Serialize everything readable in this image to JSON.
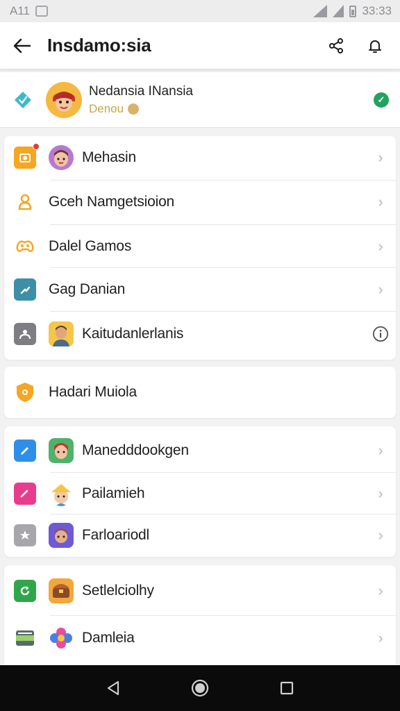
{
  "status": {
    "left_text": "A11",
    "time": "33:33"
  },
  "header": {
    "title": "Insdamo:sia"
  },
  "profile": {
    "name": "Nedansia INansia",
    "subtitle": "Denou"
  },
  "groups": [
    {
      "items": [
        {
          "label": "Mehasin",
          "icon": "camera-icon",
          "icon_color": "#f5a623",
          "avatar": "girl-avatar",
          "trailing": "chevron",
          "badge": true
        },
        {
          "label": "Gceh Namgetsioion",
          "icon": "person-icon",
          "icon_color": "#f5a623",
          "trailing": "chevron"
        },
        {
          "label": "Dalel Gamos",
          "icon": "gamepad-icon",
          "icon_color": "#f5a623",
          "trailing": "chevron"
        },
        {
          "label": "Gag Danian",
          "icon": "chart-icon",
          "icon_color": "#3d8fa8",
          "trailing": "chevron"
        },
        {
          "label": "Kaitudanlerlanis",
          "icon": "people-icon",
          "icon_color": "#7d7d82",
          "avatar": "man-avatar",
          "trailing": "info"
        }
      ]
    },
    {
      "items": [
        {
          "label": "Hadari Muiola",
          "icon": "shield-icon",
          "icon_color": "#f5a623",
          "trailing": "none"
        }
      ]
    },
    {
      "items": [
        {
          "label": "Manedddookgen",
          "icon": "edit-icon",
          "icon_color": "#2f8fe8",
          "avatar": "redhair-avatar",
          "trailing": "chevron"
        },
        {
          "label": "Pailamieh",
          "icon": "heart-icon",
          "icon_color": "#e83d8d",
          "avatar": "hat-avatar",
          "trailing": "chevron"
        },
        {
          "label": "Farloariodl",
          "icon": "star-icon",
          "icon_color": "#a6a6ab",
          "avatar": "purple-avatar",
          "trailing": "chevron"
        }
      ]
    },
    {
      "items": [
        {
          "label": "Setlelciolhy",
          "icon": "refresh-icon",
          "icon_color": "#2fa64a",
          "avatar": "chest-avatar",
          "trailing": "chevron"
        },
        {
          "label": "Damleia",
          "icon": "film-icon",
          "icon_color": "#5a6a6a",
          "avatar": "flower-avatar",
          "trailing": "chevron"
        }
      ]
    }
  ]
}
